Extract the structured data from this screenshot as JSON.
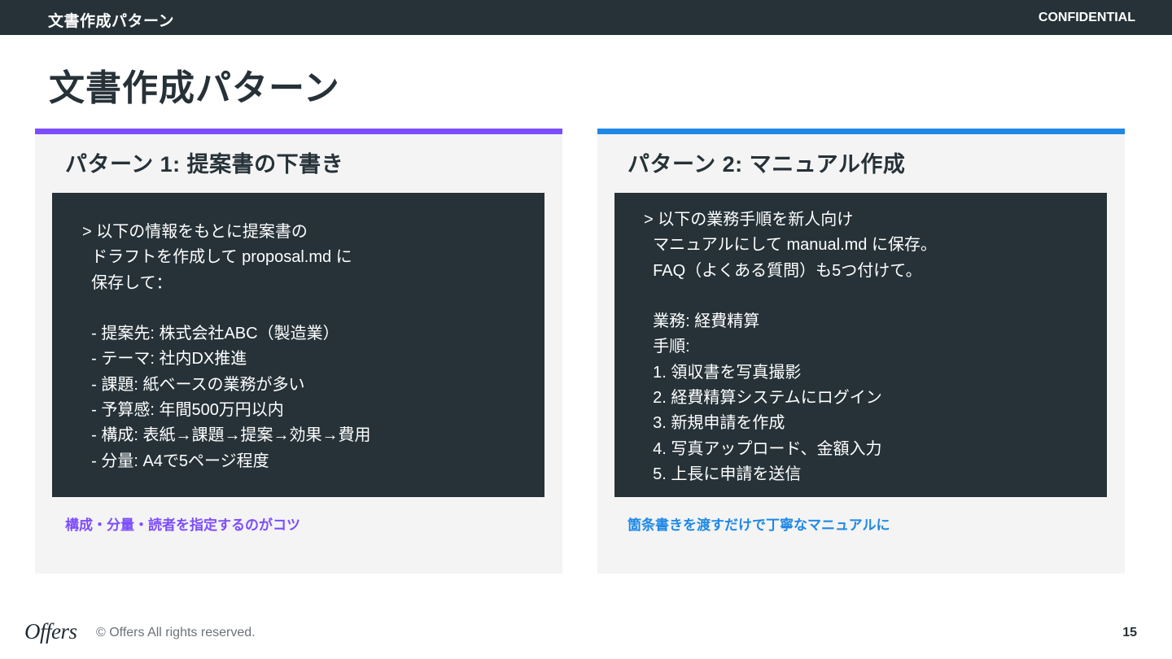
{
  "header": {
    "title": "文書作成パターン",
    "confidential": "CONFIDENTIAL"
  },
  "page": {
    "title": "文書作成パターン"
  },
  "cards": [
    {
      "accent": "#7c4dff",
      "title": "パターン 1: 提案書の下書き",
      "code": "> 以下の情報をもとに提案書の\n  ドラフトを作成して proposal.md に\n  保存して：\n\n  - 提案先: 株式会社ABC（製造業）\n  - テーマ: 社内DX推進\n  - 課題: 紙ベースの業務が多い\n  - 予算感: 年間500万円以内\n  - 構成: 表紙→課題→提案→効果→費用\n  - 分量: A4で5ページ程度",
      "tip": "構成・分量・読者を指定するのがコツ"
    },
    {
      "accent": "#1e88e5",
      "title": "パターン 2: マニュアル作成",
      "code": "> 以下の業務手順を新人向け\n  マニュアルにして manual.md に保存。\n  FAQ（よくある質問）も5つ付けて。\n\n  業務: 経費精算\n  手順:\n  1. 領収書を写真撮影\n  2. 経費精算システムにログイン\n  3. 新規申請を作成\n  4. 写真アップロード、金額入力\n  5. 上長に申請を送信",
      "tip": "箇条書きを渡すだけで丁寧なマニュアルに"
    }
  ],
  "footer": {
    "logo": "Offers",
    "copyright": "© Offers All rights reserved.",
    "page_number": "15"
  }
}
